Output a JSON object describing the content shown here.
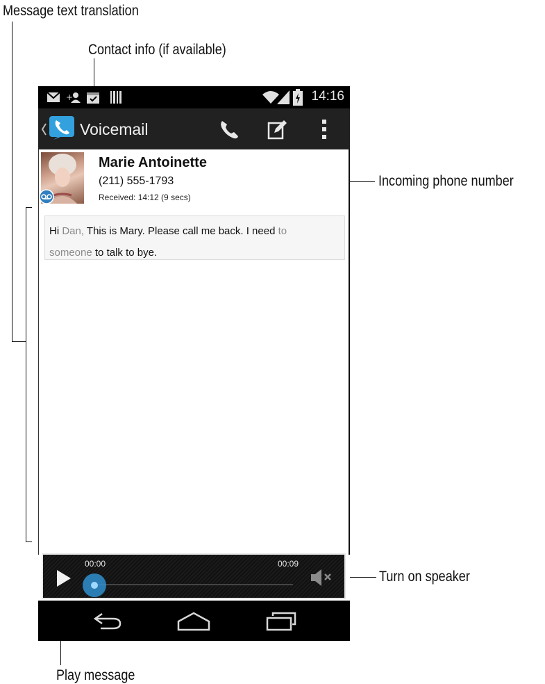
{
  "callouts": {
    "message_text_translation": "Message text translation",
    "contact_info": "Contact info (if available)",
    "incoming_phone_number": "Incoming phone number",
    "turn_on_speaker": "Turn on speaker",
    "play_message": "Play message"
  },
  "status_bar": {
    "time": "14:16"
  },
  "action_bar": {
    "title": "Voicemail"
  },
  "contact": {
    "name": "Marie Antoinette",
    "number": "(211) 555-1793",
    "received": "Received: 14:12 (9 secs)"
  },
  "message": {
    "line1_a": "Hi ",
    "line1_b": "Dan,",
    "line1_c": " This is Mary. Please call me back. I need ",
    "line1_d": "to",
    "line2_a": "someone",
    "line2_b": " to talk to bye."
  },
  "player": {
    "elapsed": "00:00",
    "duration": "00:09",
    "progress": 0
  },
  "colors": {
    "accent": "#2f8fcf",
    "low_confidence_text": "#8a8a8a"
  },
  "icons": [
    "email-icon",
    "add-contact-icon",
    "calendar-icon",
    "barcode-icon",
    "wifi-icon",
    "signal-icon",
    "battery-icon",
    "back-chevron-icon",
    "voicemail-app-icon",
    "call-icon",
    "edit-icon",
    "overflow-menu-icon",
    "voicemail-badge-icon",
    "play-icon",
    "mute-speaker-icon",
    "nav-back-icon",
    "nav-home-icon",
    "nav-recents-icon"
  ]
}
